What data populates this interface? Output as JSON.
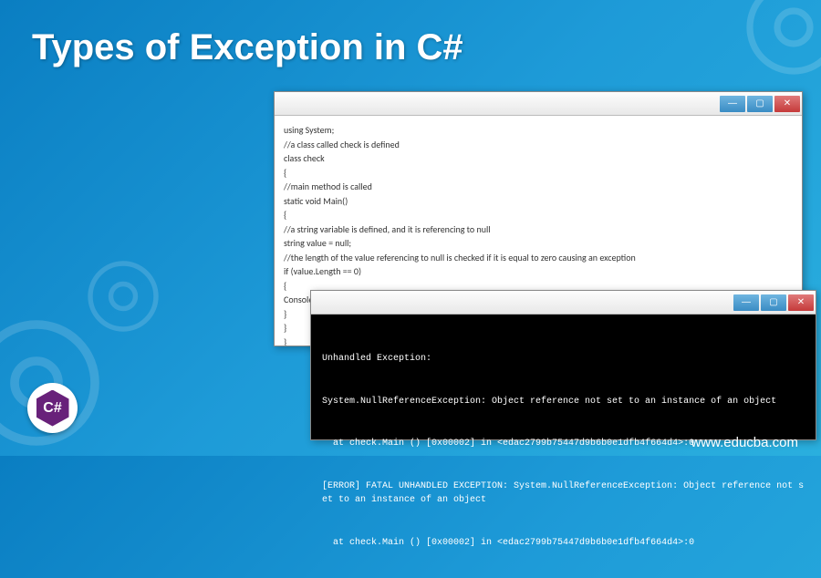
{
  "title": "Types of Exception in C#",
  "code_window": {
    "lines": [
      "using System;",
      "//a class called check is defined",
      "class check",
      "{",
      "//main method is called",
      "static void Main()",
      "{",
      "//a string variable is defined, and it is referencing to null",
      "string value = null;",
      "//the length of the value referencing to null is checked if it is equal to zero causing an exception",
      "if (value.Length == 0)",
      "{",
      "Console.WriteLin",
      "}",
      "}",
      "}"
    ]
  },
  "console_window": {
    "lines": [
      "Unhandled Exception:",
      "System.NullReferenceException: Object reference not set to an instance of an object",
      "  at check.Main () [0x00002] in <edac2799b75447d9b6b0e1dfb4f664d4>:0",
      "[ERROR] FATAL UNHANDLED EXCEPTION: System.NullReferenceException: Object reference not set to an instance of an object",
      "  at check.Main () [0x00002] in <edac2799b75447d9b6b0e1dfb4f664d4>:0"
    ]
  },
  "logo_text": "C#",
  "site_url": "www.educba.com",
  "win_btns": {
    "min": "—",
    "max": "▢",
    "close": "✕"
  }
}
